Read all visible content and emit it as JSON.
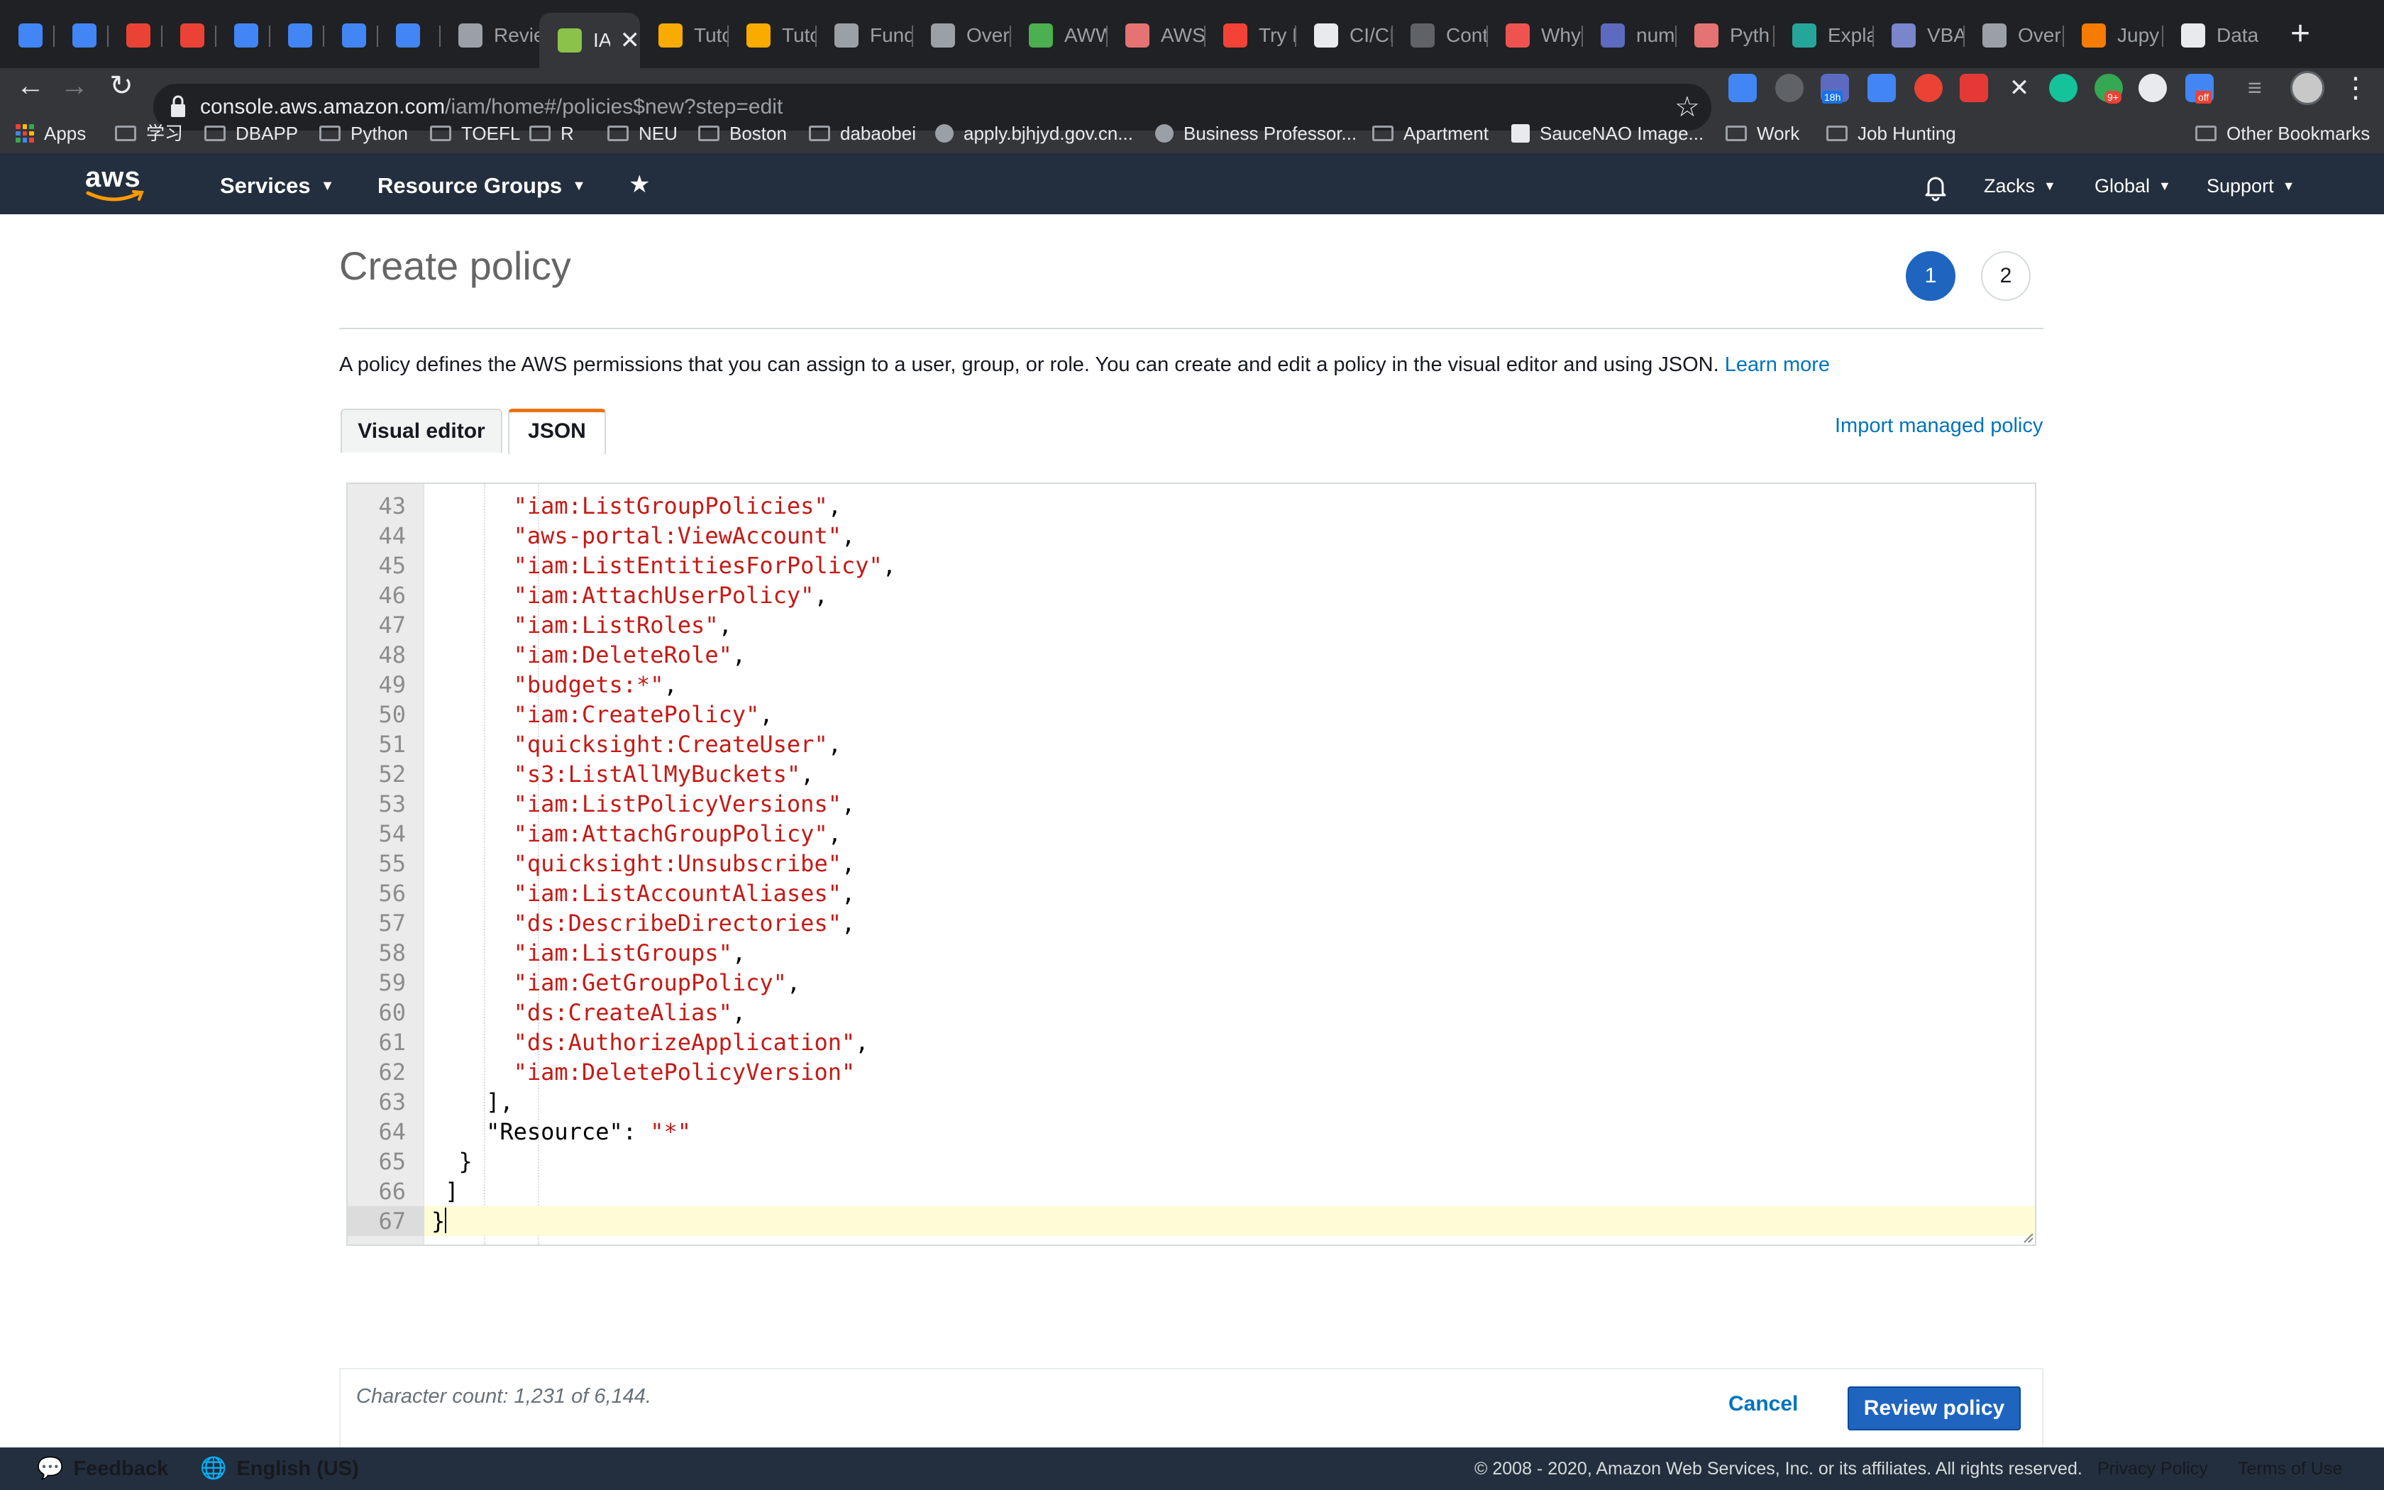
{
  "browser": {
    "tabs": [
      {
        "label": "",
        "icon": "calendar-icon",
        "color": "#4285f4"
      },
      {
        "label": "",
        "icon": "calendar-icon",
        "color": "#4285f4"
      },
      {
        "label": "",
        "icon": "gmail-icon",
        "color": "#ea4335"
      },
      {
        "label": "",
        "icon": "gmail-icon",
        "color": "#ea4335"
      },
      {
        "label": "",
        "icon": "translate-icon",
        "color": "#4285f4"
      },
      {
        "label": "",
        "icon": "translate-icon",
        "color": "#4285f4"
      },
      {
        "label": "",
        "icon": "translate-icon",
        "color": "#4285f4"
      },
      {
        "label": "",
        "icon": "translate-icon",
        "color": "#4285f4"
      },
      {
        "label": "Revie",
        "icon": "page-icon",
        "color": "#9aa0a6"
      },
      {
        "label": "IA",
        "icon": "aws-icon",
        "color": "#8bc34a",
        "active": true
      },
      {
        "label": "Tutor",
        "icon": "box-icon",
        "color": "#f9ab00"
      },
      {
        "label": "Tutor",
        "icon": "box-icon",
        "color": "#f9ab00"
      },
      {
        "label": "Fund",
        "icon": "mortarboard-icon",
        "color": "#9aa0a6"
      },
      {
        "label": "Over",
        "icon": "mortarboard-icon",
        "color": "#9aa0a6"
      },
      {
        "label": "AWW",
        "icon": "w-icon",
        "color": "#4caf50"
      },
      {
        "label": "AWS",
        "icon": "bug-icon",
        "color": "#e57373"
      },
      {
        "label": "Try D",
        "icon": "stack-icon",
        "color": "#f44336"
      },
      {
        "label": "CI/CI",
        "icon": "circle-icon",
        "color": "#e8eaed"
      },
      {
        "label": "Cont",
        "icon": "github-icon",
        "color": "#5f6368"
      },
      {
        "label": "Why",
        "icon": "flag-icon",
        "color": "#ef5350"
      },
      {
        "label": "num",
        "icon": "numpy-icon",
        "color": "#5c6bc0"
      },
      {
        "label": "Pyth",
        "icon": "bug-icon",
        "color": "#e57373"
      },
      {
        "label": "Expla",
        "icon": "stats-icon",
        "color": "#26a69a"
      },
      {
        "label": "VBA",
        "icon": "crown-icon",
        "color": "#7986cb"
      },
      {
        "label": "Over",
        "icon": "mortarboard-icon",
        "color": "#9aa0a6"
      },
      {
        "label": "Jupy",
        "icon": "jupyter-icon",
        "color": "#f57c00"
      },
      {
        "label": "Data",
        "icon": "wikipedia-icon",
        "color": "#e8eaed"
      }
    ],
    "tab_close": "✕",
    "new_tab": "+",
    "url_host": "console.aws.amazon.com",
    "url_path": "/iam/home#/policies$new?step=edit",
    "extension_badges": {
      "calendar": "18h",
      "notifications": "9+",
      "video": "off"
    },
    "bookmarks": [
      "Apps",
      "学习",
      "DBAPP",
      "Python",
      "TOEFL",
      "R",
      "NEU",
      "Boston",
      "dabaobei",
      "apply.bjhjyd.gov.cn...",
      "Business Professor...",
      "Apartment",
      "SauceNAO Image...",
      "Work",
      "Job Hunting"
    ],
    "other_bookmarks": "Other Bookmarks"
  },
  "aws_nav": {
    "logo": "aws",
    "services": "Services",
    "resource_groups": "Resource Groups",
    "user": "Zacks",
    "region": "Global",
    "support": "Support"
  },
  "page": {
    "title": "Create policy",
    "steps": [
      "1",
      "2"
    ],
    "intro": "A policy defines the AWS permissions that you can assign to a user, group, or role. You can create and edit a policy in the visual editor and using JSON.",
    "learn_more": "Learn more",
    "tabs": {
      "visual": "Visual editor",
      "json": "JSON"
    },
    "import_link": "Import managed policy"
  },
  "editor": {
    "lines": [
      {
        "n": "43",
        "indent": "      ",
        "str": "\"iam:ListGroupPolicies\"",
        "tail": ","
      },
      {
        "n": "44",
        "indent": "      ",
        "str": "\"aws-portal:ViewAccount\"",
        "tail": ","
      },
      {
        "n": "45",
        "indent": "      ",
        "str": "\"iam:ListEntitiesForPolicy\"",
        "tail": ","
      },
      {
        "n": "46",
        "indent": "      ",
        "str": "\"iam:AttachUserPolicy\"",
        "tail": ","
      },
      {
        "n": "47",
        "indent": "      ",
        "str": "\"iam:ListRoles\"",
        "tail": ","
      },
      {
        "n": "48",
        "indent": "      ",
        "str": "\"iam:DeleteRole\"",
        "tail": ","
      },
      {
        "n": "49",
        "indent": "      ",
        "str": "\"budgets:*\"",
        "tail": ","
      },
      {
        "n": "50",
        "indent": "      ",
        "str": "\"iam:CreatePolicy\"",
        "tail": ","
      },
      {
        "n": "51",
        "indent": "      ",
        "str": "\"quicksight:CreateUser\"",
        "tail": ","
      },
      {
        "n": "52",
        "indent": "      ",
        "str": "\"s3:ListAllMyBuckets\"",
        "tail": ","
      },
      {
        "n": "53",
        "indent": "      ",
        "str": "\"iam:ListPolicyVersions\"",
        "tail": ","
      },
      {
        "n": "54",
        "indent": "      ",
        "str": "\"iam:AttachGroupPolicy\"",
        "tail": ","
      },
      {
        "n": "55",
        "indent": "      ",
        "str": "\"quicksight:Unsubscribe\"",
        "tail": ","
      },
      {
        "n": "56",
        "indent": "      ",
        "str": "\"iam:ListAccountAliases\"",
        "tail": ","
      },
      {
        "n": "57",
        "indent": "      ",
        "str": "\"ds:DescribeDirectories\"",
        "tail": ","
      },
      {
        "n": "58",
        "indent": "      ",
        "str": "\"iam:ListGroups\"",
        "tail": ","
      },
      {
        "n": "59",
        "indent": "      ",
        "str": "\"iam:GetGroupPolicy\"",
        "tail": ","
      },
      {
        "n": "60",
        "indent": "      ",
        "str": "\"ds:CreateAlias\"",
        "tail": ","
      },
      {
        "n": "61",
        "indent": "      ",
        "str": "\"ds:AuthorizeApplication\"",
        "tail": ","
      },
      {
        "n": "62",
        "indent": "      ",
        "str": "\"iam:DeletePolicyVersion\"",
        "tail": ""
      },
      {
        "n": "63",
        "indent": "    ",
        "pre": "],",
        "str": "",
        "tail": ""
      },
      {
        "n": "64",
        "indent": "    ",
        "pre": "\"Resource\": ",
        "str": "\"*\"",
        "tail": ""
      },
      {
        "n": "65",
        "indent": "  ",
        "pre": "}",
        "str": "",
        "tail": ""
      },
      {
        "n": "66",
        "indent": " ",
        "pre": "]",
        "str": "",
        "tail": ""
      },
      {
        "n": "67",
        "indent": "",
        "pre": "}",
        "str": "",
        "tail": "",
        "current": true
      }
    ]
  },
  "footer": {
    "char_count": "Character count: 1,231 of 6,144.",
    "cancel": "Cancel",
    "review": "Review policy"
  },
  "statusbar": {
    "feedback": "Feedback",
    "language": "English (US)",
    "copyright": "© 2008 - 2020, Amazon Web Services, Inc. or its affiliates. All rights reserved.",
    "privacy": "Privacy Policy",
    "terms": "Terms of Use"
  },
  "colors": {
    "aws_nav": "#232f3e",
    "primary_button": "#1f65c0",
    "link": "#0073bb",
    "tab_accent": "#ec7211",
    "json_string": "#c41a16",
    "current_line": "#fdfcd6"
  }
}
